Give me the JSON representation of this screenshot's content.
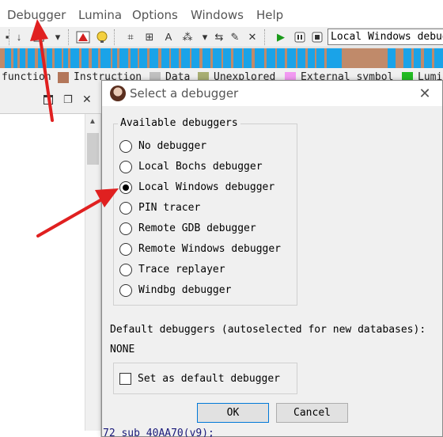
{
  "menu": [
    "Debugger",
    "Lumina",
    "Options",
    "Windows",
    "Help"
  ],
  "toolbar": {
    "debugger_select": "Local Windows debugger",
    "icons": [
      "down-arrow-icon",
      "flag-icon",
      "dropdown-icon",
      "warning-icon",
      "bulb-icon",
      "code-icon",
      "data-icon",
      "text-icon",
      "struct-icon",
      "dropdown-icon",
      "edit-icon",
      "close-icon",
      "play-icon",
      "pause-icon",
      "stop-icon"
    ]
  },
  "legend": [
    "function",
    "Instruction",
    "Data",
    "Unexplored",
    "External symbol",
    "Lumi"
  ],
  "colors": {
    "nav_blue": "#1aa3e8",
    "nav_brown": "#c08a6a",
    "legend_instruction": "#b3765a",
    "legend_data": "#c0c0c0",
    "legend_unexplored": "#a8ae72",
    "legend_external": "#f29af2",
    "legend_lumina": "#22bb22",
    "focus_blue": "#0078d7"
  },
  "dialog": {
    "title": "Select a debugger",
    "group_title": "Available debuggers",
    "options": [
      {
        "label": "No debugger",
        "checked": false
      },
      {
        "label": "Local Bochs debugger",
        "checked": false
      },
      {
        "label": "Local Windows debugger",
        "checked": true
      },
      {
        "label": "PIN tracer",
        "checked": false
      },
      {
        "label": "Remote GDB debugger",
        "checked": false
      },
      {
        "label": "Remote Windows debugger",
        "checked": false
      },
      {
        "label": "Trace replayer",
        "checked": false
      },
      {
        "label": "Windbg debugger",
        "checked": false
      }
    ],
    "default_label": "Default debuggers (autoselected for new databases):",
    "default_value": "NONE",
    "checkbox_label": "Set as default debugger",
    "ok_label": "OK",
    "cancel_label": "Cancel"
  },
  "code_peek": "72 sub_40AA70(v9);"
}
